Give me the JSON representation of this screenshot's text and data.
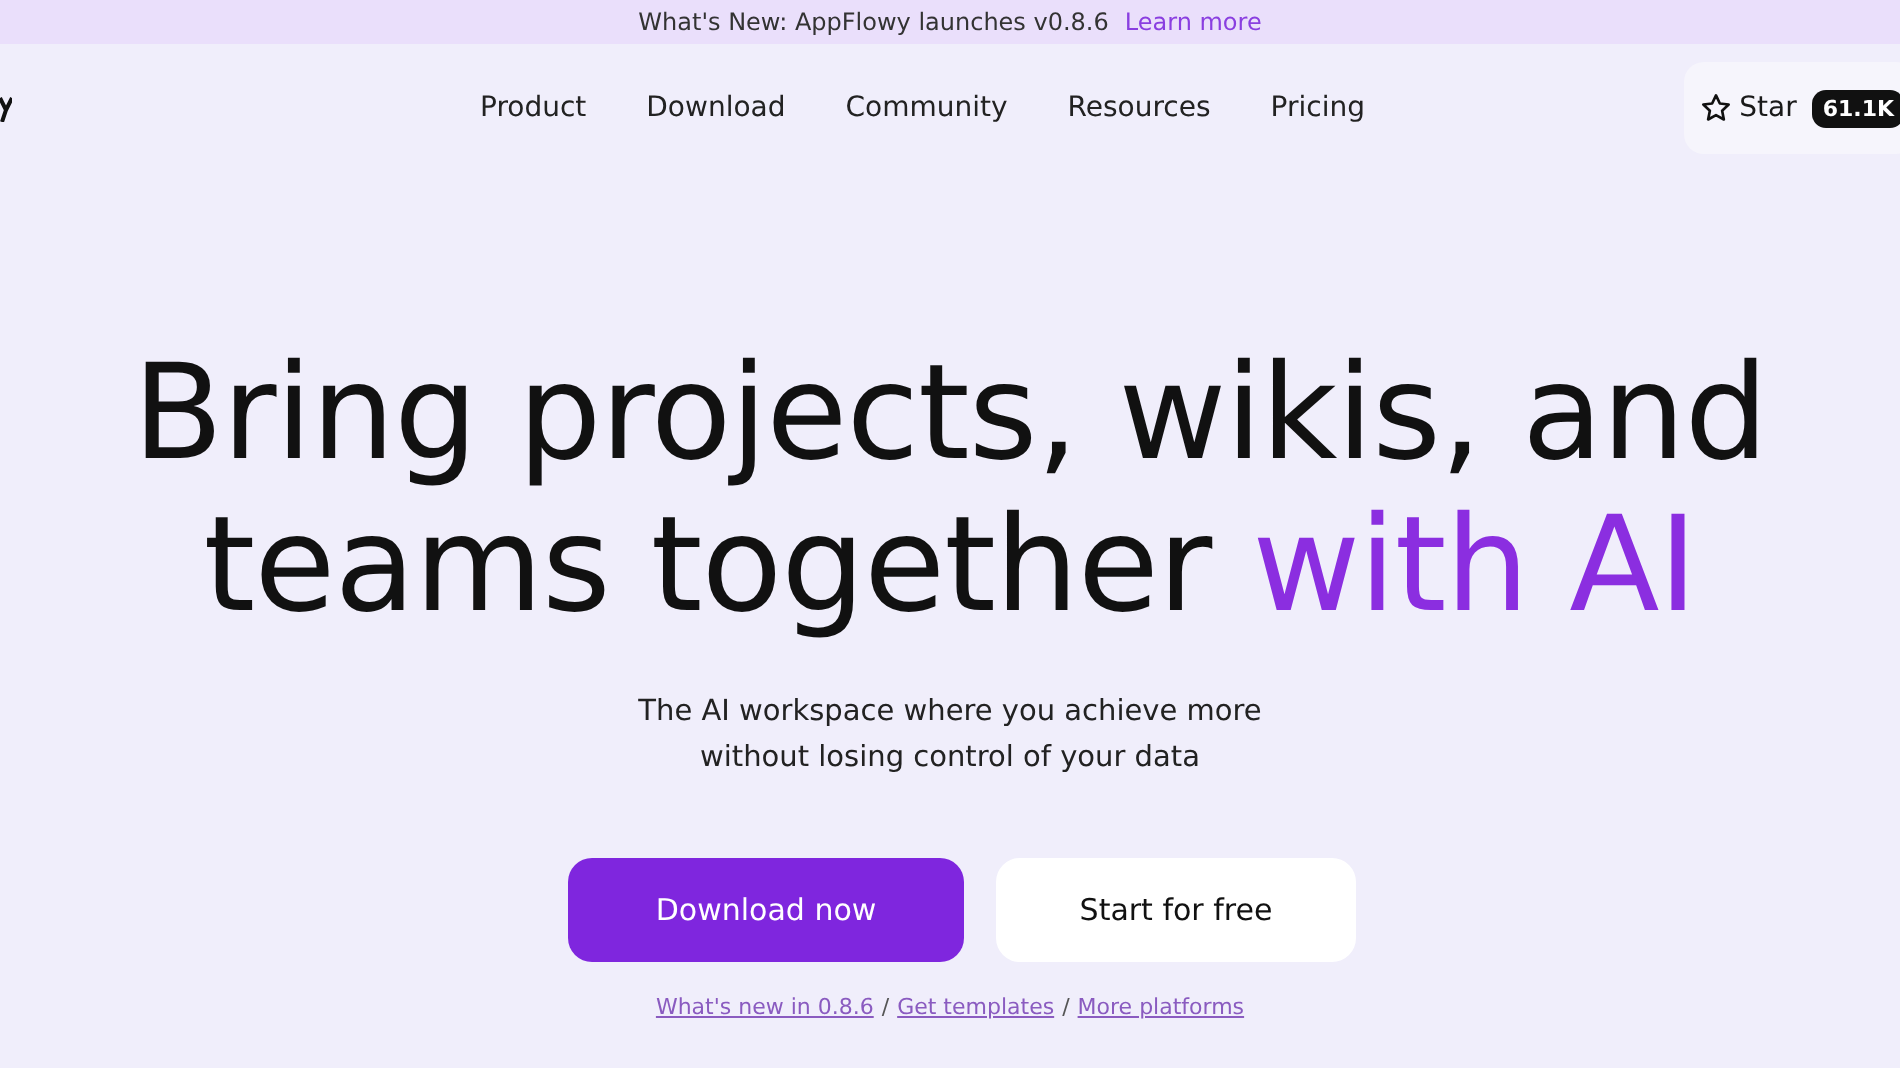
{
  "announcement": {
    "text": "What's New: AppFlowy launches v0.8.6",
    "link": "Learn more"
  },
  "nav": [
    "Product",
    "Download",
    "Community",
    "Resources",
    "Pricing"
  ],
  "github": {
    "label": "Star",
    "count": "61.1K"
  },
  "hero": {
    "line1": "Bring projects, wikis, and",
    "line2_plain": "teams together",
    "line2_accent": "with AI",
    "subtitle_lines": [
      "The AI workspace where you achieve more",
      "without losing control of your data"
    ]
  },
  "buttons": [
    {
      "label": "Download now",
      "kind": "primary"
    },
    {
      "label": "Start for free",
      "kind": "secondary"
    }
  ],
  "links": [
    "What's new in 0.8.6",
    "Get templates",
    "More platforms"
  ],
  "link_separator": "/"
}
